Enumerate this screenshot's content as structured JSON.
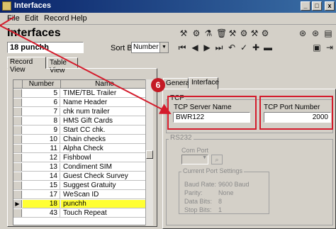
{
  "window": {
    "title": "Interfaces",
    "min": "_",
    "max": "□",
    "close": "x"
  },
  "menu": [
    "File",
    "Edit",
    "Record",
    "Help"
  ],
  "form": {
    "title": "Interfaces",
    "record_value": "18 punchh",
    "sortby_label": "Sort By",
    "sortby_value": "Number"
  },
  "tabs": {
    "record_view": "Record View",
    "table_view": "Table View"
  },
  "grid": {
    "headers": [
      "Number",
      "Name"
    ],
    "rows": [
      {
        "num": "5",
        "name": "TIME/TBL Trailer"
      },
      {
        "num": "6",
        "name": "Name Header"
      },
      {
        "num": "7",
        "name": "chk num trailer"
      },
      {
        "num": "8",
        "name": "HMS Gift Cards"
      },
      {
        "num": "9",
        "name": "Start CC chk."
      },
      {
        "num": "10",
        "name": "Chain checks"
      },
      {
        "num": "11",
        "name": "Alpha Check"
      },
      {
        "num": "12",
        "name": "Fishbowl"
      },
      {
        "num": "13",
        "name": "Condiment SIM"
      },
      {
        "num": "14",
        "name": "Guest Check Survey"
      },
      {
        "num": "15",
        "name": "Suggest Gratuity"
      },
      {
        "num": "17",
        "name": "WeScan ID"
      },
      {
        "num": "18",
        "name": "punchh",
        "selected": true
      },
      {
        "num": "43",
        "name": "Touch Repeat"
      }
    ],
    "selector": "▶"
  },
  "detail_tabs": {
    "general": "General",
    "interface": "Interface"
  },
  "callout": "6",
  "tcp": {
    "group_label": "TCP",
    "server_label": "TCP Server Name",
    "server_value": "BWR122",
    "port_label": "TCP Port Number",
    "port_value": "2000"
  },
  "rs232": {
    "group_label": "RS232",
    "com_port_label": "Com Port",
    "current_settings_label": "Current Port Settings",
    "settings": [
      {
        "label": "Baud Rate:",
        "value": "9600 Baud"
      },
      {
        "label": "Parity:",
        "value": "None"
      },
      {
        "label": "Data Bits:",
        "value": "8"
      },
      {
        "label": "Stop Bits:",
        "value": "1"
      }
    ]
  },
  "colors": {
    "accent_red": "#d41c2c",
    "highlight_yellow": "#ffff33",
    "titlebar_blue": "#0a246a"
  }
}
